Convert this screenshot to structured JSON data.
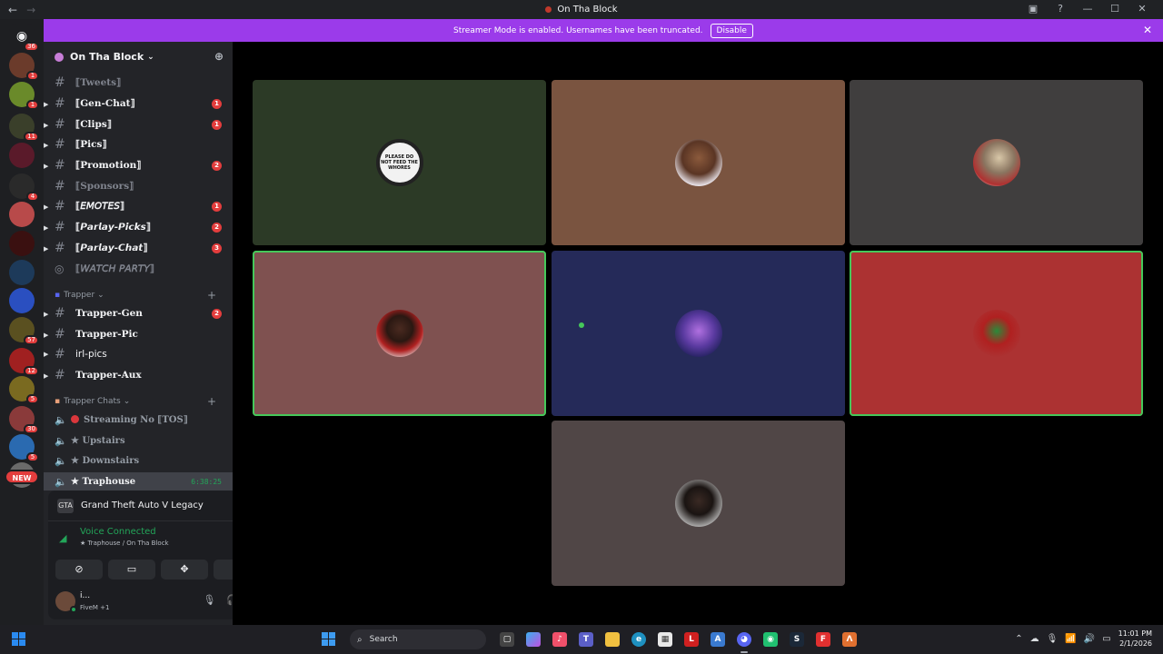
{
  "window": {
    "title": "On Tha Block",
    "back_icon": "←",
    "forward_icon": "→",
    "controls": [
      "inbox-icon",
      "help-icon",
      "minimize",
      "maximize",
      "close"
    ]
  },
  "banner": {
    "message": "Streamer Mode is enabled. Usernames have been truncated.",
    "disable_label": "Disable",
    "close_icon": "✕",
    "color": "#9b3bea"
  },
  "servers": [
    {
      "badge": "36"
    },
    {
      "badge": "1"
    },
    {
      "badge": "1"
    },
    {
      "badge": "11"
    },
    {
      "badge": ""
    },
    {
      "badge": "4"
    },
    {
      "badge": ""
    },
    {
      "badge": ""
    },
    {
      "badge": ""
    },
    {
      "badge": ""
    },
    {
      "badge": "57"
    },
    {
      "badge": "12"
    },
    {
      "badge": "5"
    },
    {
      "badge": "30"
    },
    {
      "badge": "5"
    }
  ],
  "new_badge": "NEW",
  "guild": {
    "name": "On Tha Block",
    "caret": "⌄"
  },
  "channels": [
    {
      "name": "⟦Tweets⟧",
      "badge": "",
      "muted": true,
      "expand": false,
      "italic": false
    },
    {
      "name": "⟦Gen-Chat⟧",
      "badge": "1",
      "muted": false,
      "expand": true,
      "italic": false
    },
    {
      "name": "⟦Clips⟧",
      "badge": "1",
      "muted": false,
      "expand": true,
      "italic": false
    },
    {
      "name": "⟦Pics⟧",
      "badge": "",
      "muted": false,
      "expand": true,
      "italic": false
    },
    {
      "name": "⟦Promotion⟧",
      "badge": "2",
      "muted": false,
      "expand": true,
      "italic": false
    },
    {
      "name": "⟦Sponsors⟧",
      "badge": "",
      "muted": true,
      "expand": false,
      "italic": false
    },
    {
      "name": "⟦𝘌𝘔𝘖𝘛𝘌𝘚⟧",
      "badge": "1",
      "muted": false,
      "expand": true,
      "italic": true
    },
    {
      "name": "⟦𝙋𝙖𝙧𝙡𝙖𝙮-𝙋𝙞𝙘𝙠𝙨⟧",
      "badge": "2",
      "muted": false,
      "expand": true,
      "italic": true
    },
    {
      "name": "⟦𝙋𝙖𝙧𝙡𝙖𝙮-𝘾𝙝𝙖𝙩⟧",
      "badge": "3",
      "muted": false,
      "expand": true,
      "italic": true
    },
    {
      "name": "⟦𝘞𝘈𝘛𝘊𝘏 𝘗𝘈𝘙𝘛𝘠⟧",
      "badge": "",
      "muted": true,
      "expand": false,
      "italic": true
    }
  ],
  "category1": {
    "name": "Trapper",
    "caret": "⌄",
    "plus": "+"
  },
  "channels2": [
    {
      "name": "Trapper-Gen",
      "badge": "2",
      "muted": false
    },
    {
      "name": "Trapper-Pic",
      "badge": "",
      "muted": false
    },
    {
      "name": "irl-pics",
      "badge": "",
      "muted": false
    },
    {
      "name": "Trapper-Aux",
      "badge": "",
      "muted": false
    }
  ],
  "category2": {
    "name": "Trapper Chats",
    "caret": "⌄",
    "plus": "+"
  },
  "voice_channels": [
    {
      "name": "Streaming No ⟦TOS⟧",
      "dot": true,
      "active": false,
      "timer": ""
    },
    {
      "name": "★ Upstairs",
      "dot": false,
      "active": false,
      "timer": ""
    },
    {
      "name": "★ Downstairs",
      "dot": false,
      "active": false,
      "timer": ""
    },
    {
      "name": "★ Traphouse",
      "dot": false,
      "active": true,
      "timer": "6:38:25"
    }
  ],
  "activity": {
    "game": "Grand Theft Auto V Legacy",
    "icon": "GTA"
  },
  "voice": {
    "status": "Voice Connected",
    "sub": "★ Traphouse / On Tha Block"
  },
  "voice_buttons": [
    "camera-off-icon",
    "screen-share-icon",
    "activities-icon",
    "soundboard-icon"
  ],
  "user": {
    "name": "i...",
    "status": "FiveM +1"
  },
  "tiles": [
    {
      "name": "tile-1",
      "bg": "#2c3a26",
      "speaking": false,
      "avatar": "sign"
    },
    {
      "name": "tile-2",
      "bg": "#7a5440",
      "speaking": false,
      "avatar": "photo"
    },
    {
      "name": "tile-3",
      "bg": "#403e3e",
      "speaking": false,
      "avatar": "photo"
    },
    {
      "name": "tile-4",
      "bg": "#7f5150",
      "speaking": true,
      "avatar": "photo"
    },
    {
      "name": "tile-5",
      "bg": "#252a59",
      "speaking": false,
      "avatar": "photo"
    },
    {
      "name": "tile-6",
      "bg": "#ac3232",
      "speaking": true,
      "avatar": "photo"
    },
    {
      "name": "tile-7",
      "bg": "#504646",
      "speaking": false,
      "avatar": "photo"
    }
  ],
  "sign_text": "PLEASE DO NOT FEED THE WHORES",
  "taskbar": {
    "search_placeholder": "Search",
    "time": "11:01 PM",
    "date": "2/1/2026"
  }
}
